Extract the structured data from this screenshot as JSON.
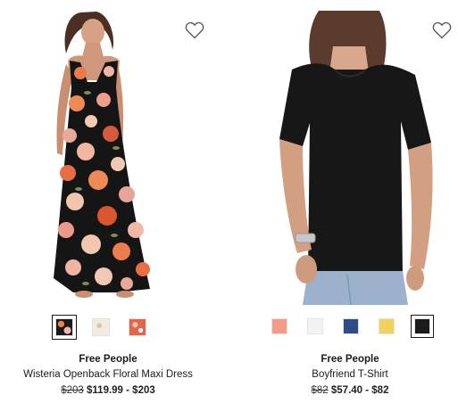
{
  "products": [
    {
      "brand": "Free People",
      "name": "Wisteria Openback Floral Maxi Dress",
      "price_original": "$203",
      "price_sale": "$119.99 - $203",
      "wishlist_icon": "heart-outline-icon",
      "swatches": [
        {
          "color": "#1c1a1a",
          "accent": "#e8834e",
          "selected": true
        },
        {
          "color": "#f1ece2",
          "accent": "#d7c5a8",
          "selected": false
        },
        {
          "color": "#e4654a",
          "accent": "#f3c2a8",
          "selected": false
        }
      ]
    },
    {
      "brand": "Free People",
      "name": "Boyfriend T-Shirt",
      "price_original": "$82",
      "price_sale": "$57.40 - $82",
      "wishlist_icon": "heart-outline-icon",
      "swatches": [
        {
          "color": "#f49b86",
          "selected": false
        },
        {
          "color": "#f3f3f3",
          "selected": false
        },
        {
          "color": "#2e4d87",
          "selected": false
        },
        {
          "color": "#f3d25a",
          "selected": false
        },
        {
          "color": "#1b1b1b",
          "selected": true
        }
      ]
    }
  ]
}
